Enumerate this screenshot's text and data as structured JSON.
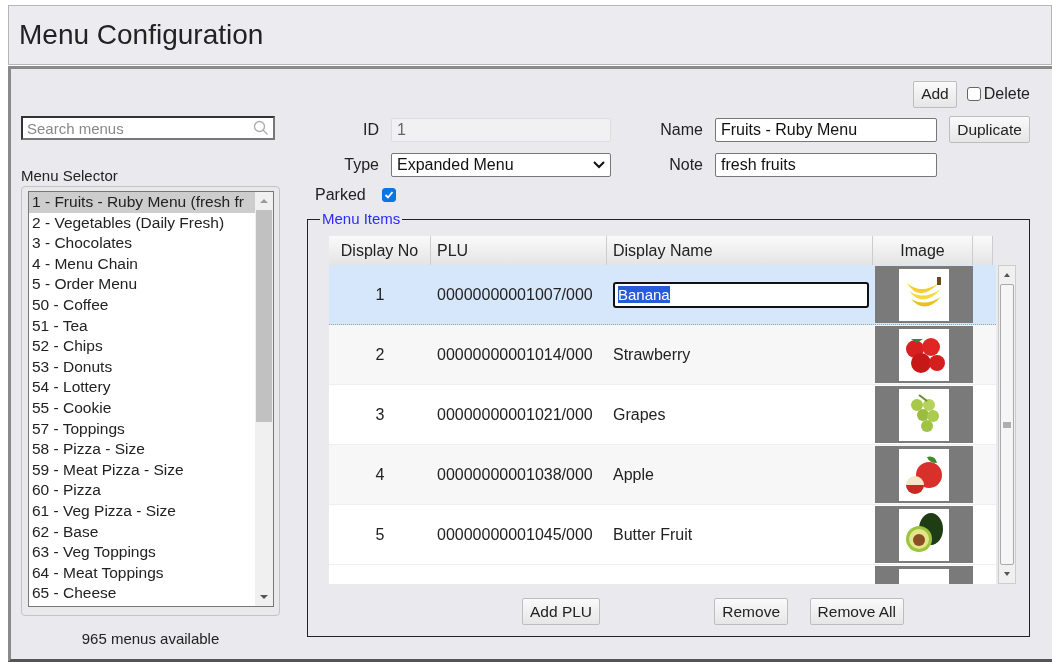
{
  "title": "Menu Configuration",
  "toolbar": {
    "add_button": "Add",
    "delete": {
      "label": "Delete",
      "checked": false
    }
  },
  "search": {
    "placeholder": "Search menus"
  },
  "menu_selector": {
    "label": "Menu Selector",
    "items": [
      {
        "label": "1 - Fruits - Ruby Menu (fresh fr",
        "selected": true
      },
      {
        "label": "2 - Vegetables (Daily Fresh)",
        "selected": false
      },
      {
        "label": "3 - Chocolates",
        "selected": false
      },
      {
        "label": "4 - Menu Chain",
        "selected": false
      },
      {
        "label": "5 - Order Menu",
        "selected": false
      },
      {
        "label": "50 - Coffee",
        "selected": false
      },
      {
        "label": "51 - Tea",
        "selected": false
      },
      {
        "label": "52 - Chips",
        "selected": false
      },
      {
        "label": "53 - Donuts",
        "selected": false
      },
      {
        "label": "54 - Lottery",
        "selected": false
      },
      {
        "label": "55 - Cookie",
        "selected": false
      },
      {
        "label": "57 - Toppings",
        "selected": false
      },
      {
        "label": "58 - Pizza - Size",
        "selected": false
      },
      {
        "label": "59 - Meat Pizza - Size",
        "selected": false
      },
      {
        "label": "60 - Pizza",
        "selected": false
      },
      {
        "label": "61 - Veg Pizza - Size",
        "selected": false
      },
      {
        "label": "62 - Base",
        "selected": false
      },
      {
        "label": "63 - Veg Toppings",
        "selected": false
      },
      {
        "label": "64 - Meat Toppings",
        "selected": false
      },
      {
        "label": "65 - Cheese",
        "selected": false
      }
    ],
    "count": "965 menus available"
  },
  "form": {
    "id": {
      "label": "ID",
      "value": "1",
      "disabled": true
    },
    "name": {
      "label": "Name",
      "value": "Fruits - Ruby Menu"
    },
    "duplicate_button": "Duplicate",
    "type": {
      "label": "Type",
      "value": "Expanded Menu"
    },
    "note": {
      "label": "Note",
      "value": "fresh fruits"
    },
    "parked": {
      "label": "Parked",
      "checked": true
    }
  },
  "menu_items": {
    "legend": "Menu Items",
    "columns": [
      "Display No",
      "PLU",
      "Display Name",
      "Image"
    ],
    "rows": [
      {
        "display_no": "1",
        "plu": "00000000001007/000",
        "display_name": "Banana",
        "selected": true
      },
      {
        "display_no": "2",
        "plu": "00000000001014/000",
        "display_name": "Strawberry",
        "selected": false
      },
      {
        "display_no": "3",
        "plu": "00000000001021/000",
        "display_name": "Grapes",
        "selected": false
      },
      {
        "display_no": "4",
        "plu": "00000000001038/000",
        "display_name": "Apple",
        "selected": false
      },
      {
        "display_no": "5",
        "plu": "00000000001045/000",
        "display_name": "Butter Fruit",
        "selected": false
      }
    ],
    "buttons": [
      "Add PLU",
      "Remove",
      "Remove All"
    ]
  }
}
